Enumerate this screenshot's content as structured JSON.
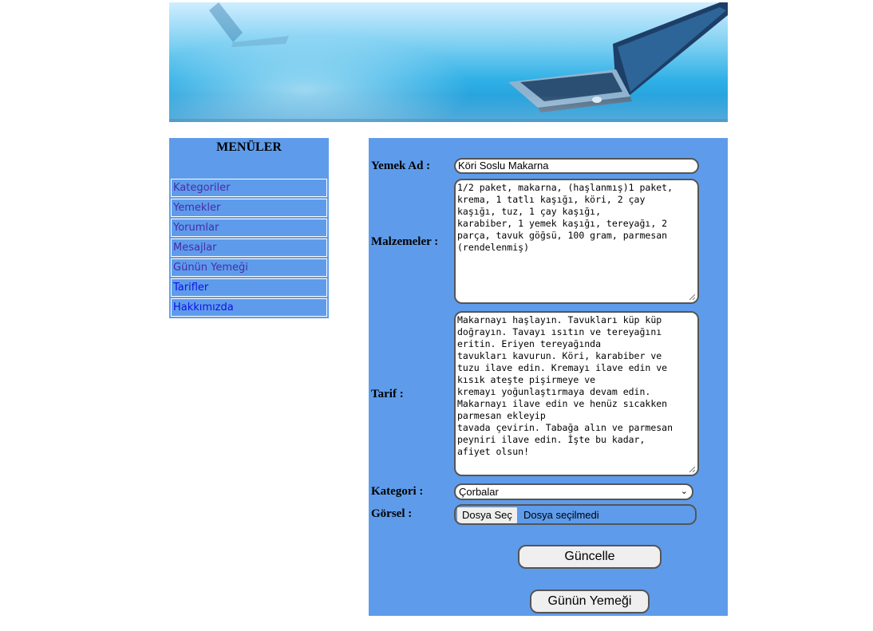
{
  "sidebar": {
    "title": "MENÜLER",
    "items": [
      {
        "label": "Kategoriler"
      },
      {
        "label": "Yemekler"
      },
      {
        "label": "Yorumlar"
      },
      {
        "label": "Mesajlar"
      },
      {
        "label": "Günün Yemeği"
      },
      {
        "label": "Tarifler"
      },
      {
        "label": "Hakkımızda"
      }
    ]
  },
  "form": {
    "name_label": "Yemek Ad :",
    "name_value": "Köri Soslu Makarna",
    "ingredients_label": "Malzemeler :",
    "ingredients_value": "1/2 paket, makarna, (haşlanmış)1 paket,\nkrema, 1 tatlı kaşığı, köri, 2 çay\nkaşığı, tuz, 1 çay kaşığı,\nkarabiber, 1 yemek kaşığı, tereyağı, 2\nparça, tavuk göğsü, 100 gram, parmesan\n(rendelenmiş)",
    "recipe_label": "Tarif :",
    "recipe_value": "Makarnayı haşlayın. Tavukları küp küp\ndoğrayın. Tavayı ısıtın ve tereyağını\neritin. Eriyen tereyağında\ntavukları kavurun. Köri, karabiber ve\ntuzu ilave edin. Kremayı ilave edin ve\nkısık ateşte pişirmeye ve\nkremayı yoğunlaştırmaya devam edin.\nMakarnayı ilave edin ve henüz sıcakken\nparmesan ekleyip\ntavada çevirin. Tabağa alın ve parmesan\npeyniri ilave edin. İşte bu kadar,\nafiyet olsun!",
    "category_label": "Kategori :",
    "category_value": "Çorbalar",
    "image_label": "Görsel :",
    "file_button": "Dosya Seç",
    "file_status": "Dosya seçilmedi",
    "update_button": "Güncelle",
    "daily_button": "Günün Yemeği"
  },
  "colors": {
    "panel": "#5e9ceb",
    "menu_visited_link": "#4a2aa8",
    "menu_link": "#1010e6"
  },
  "icons": {
    "banner": "laptop-banner",
    "select": "chevron-down-icon",
    "resize": "resize-grip-icon"
  }
}
